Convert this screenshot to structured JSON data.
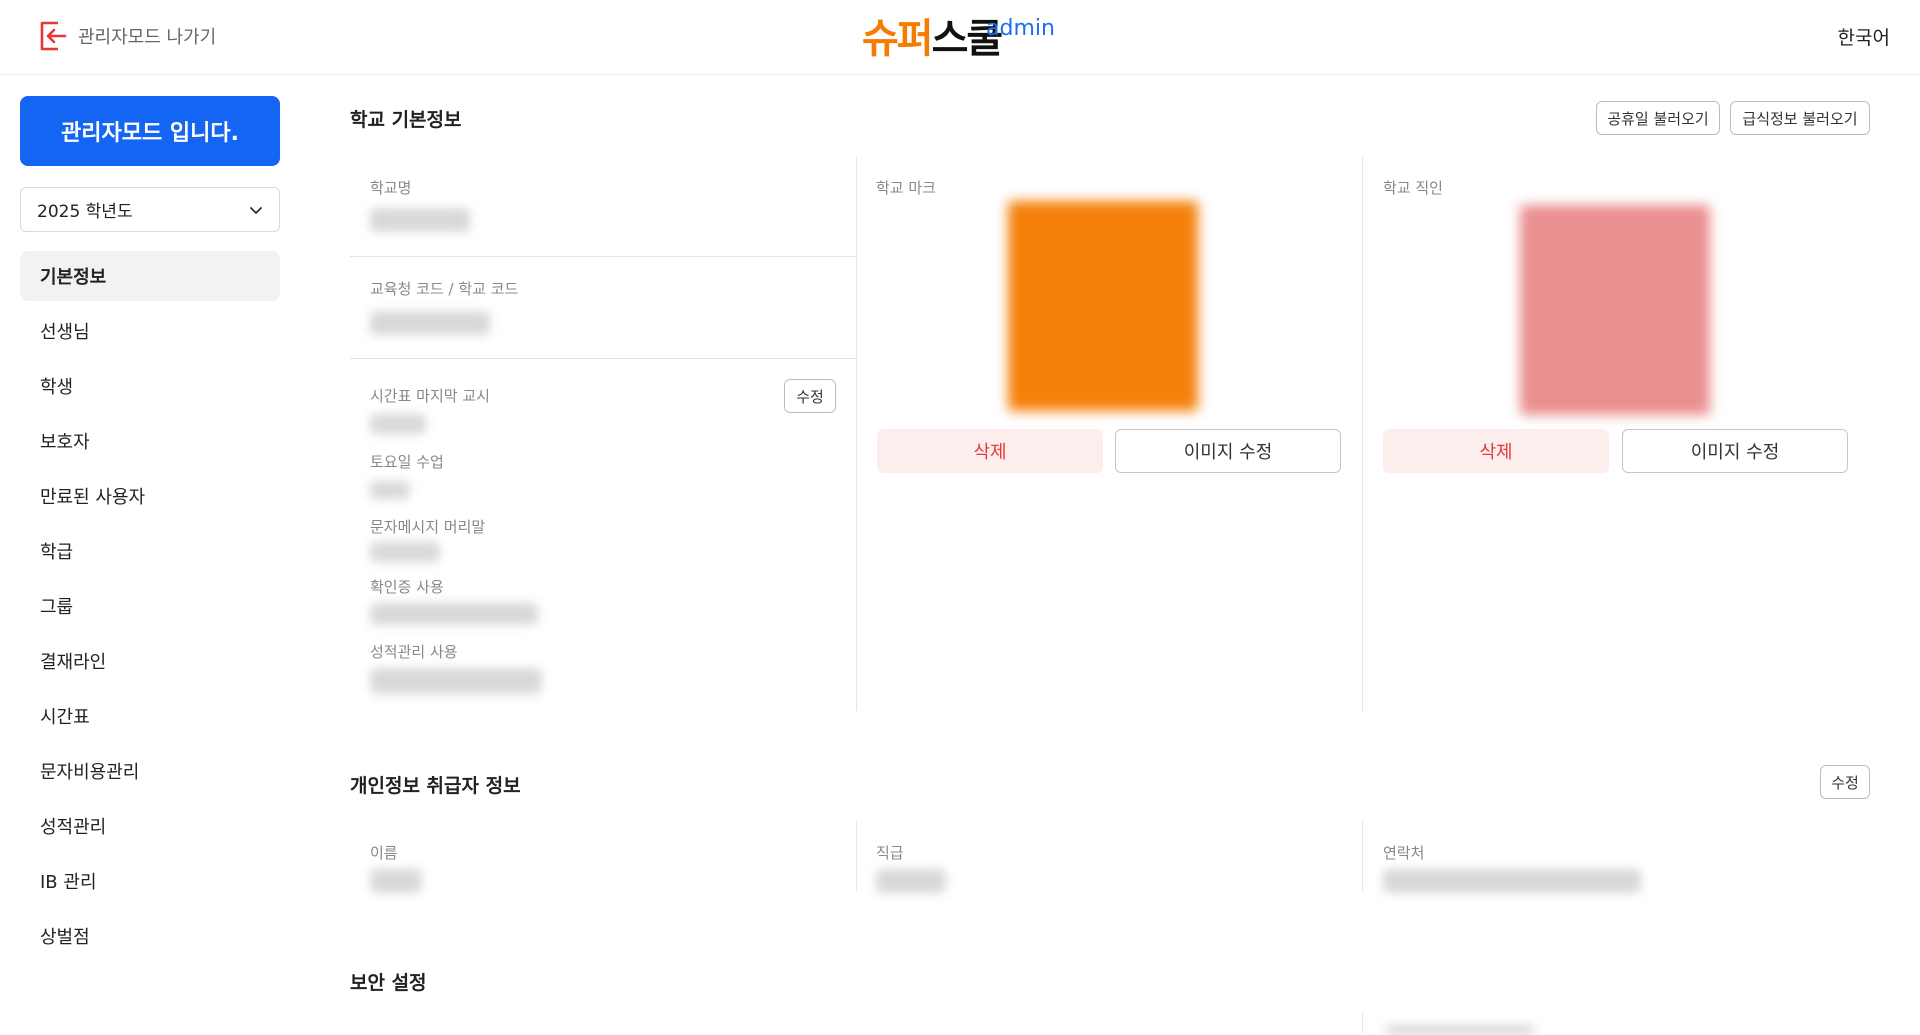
{
  "header": {
    "exit_label": "관리자모드 나가기",
    "logo_text_orange": "슈퍼",
    "logo_text_black": "스쿨",
    "logo_admin": "admin",
    "language": "한국어"
  },
  "sidebar": {
    "banner": "관리자모드 입니다.",
    "year_select": "2025 학년도",
    "items": [
      {
        "label": "기본정보",
        "active": true
      },
      {
        "label": "선생님"
      },
      {
        "label": "학생"
      },
      {
        "label": "보호자"
      },
      {
        "label": "만료된 사용자"
      },
      {
        "label": "학급"
      },
      {
        "label": "그룹"
      },
      {
        "label": "결재라인"
      },
      {
        "label": "시간표"
      },
      {
        "label": "문자비용관리"
      },
      {
        "label": "성적관리"
      },
      {
        "label": "IB 관리"
      },
      {
        "label": "상벌점"
      }
    ]
  },
  "school_info": {
    "title": "학교 기본정보",
    "holiday_button": "공휴일 불러오기",
    "meal_button": "급식정보 불러오기",
    "school_name_label": "학교명",
    "code_label": "교육청 코드 / 학교 코드",
    "last_period_label": "시간표 마지막 교시",
    "edit_button": "수정",
    "saturday_label": "토요일 수업",
    "sms_header_label": "문자메시지 머리말",
    "certificate_label": "확인증 사용",
    "grade_mgmt_label": "성적관리 사용",
    "mark_label": "학교 마크",
    "seal_label": "학교 직인",
    "delete_button": "삭제",
    "edit_image_button": "이미지 수정"
  },
  "privacy": {
    "title": "개인정보 취급자 정보",
    "edit_button": "수정",
    "name_label": "이름",
    "position_label": "직급",
    "contact_label": "연락처"
  },
  "security": {
    "title": "보안 설정"
  },
  "colors": {
    "primary": "#1565f5",
    "logo_orange": "#f57c00",
    "delete_red": "#e53935"
  }
}
